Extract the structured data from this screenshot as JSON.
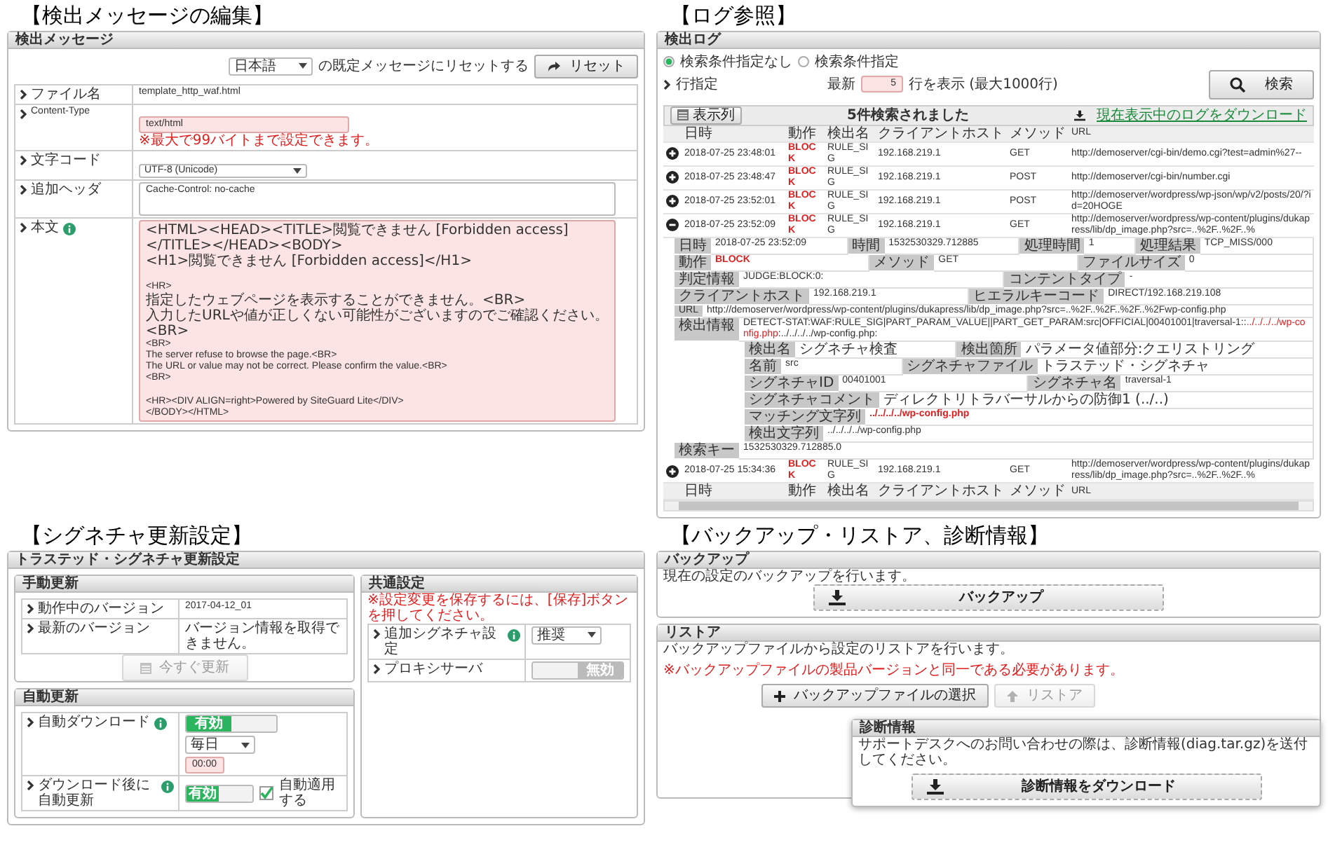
{
  "message_edit": {
    "caption": "【検出メッセージの編集】",
    "header": "検出メッセージ",
    "language": "日本語",
    "reset_text": "の既定メッセージにリセットする",
    "reset_button": "リセット",
    "rows": [
      {
        "kind": "text",
        "label": "ファイル名",
        "value": "template_http_waf.html"
      },
      {
        "kind": "input",
        "label": "Content-Type",
        "value": "text/html",
        "invalid": true,
        "note": "※最大で99バイトまで設定できます。"
      },
      {
        "kind": "select",
        "label": "文字コード",
        "value": "UTF-8 (Unicode)"
      },
      {
        "kind": "textarea",
        "label": "追加ヘッダ",
        "invalid": false,
        "blocks": [
          [
            "Cache-Control: no-cache"
          ]
        ]
      },
      {
        "kind": "textarea",
        "label": "本文",
        "info": true,
        "invalid": true,
        "blocks": [
          [
            "<HTML><HEAD><TITLE>閲覧できません [Forbidden access]</TITLE></HEAD><BODY>",
            "<H1>閲覧できません [Forbidden access]</H1>"
          ],
          [
            "<HR>",
            "指定したウェブページを表示することができません。<BR>",
            "入力したURLや値が正しくない可能性がございますのでご確認ください。<BR>",
            "<BR>",
            "The server refuse to browse the page.<BR>",
            "The URL or value may not be correct. Please confirm the value.<BR>",
            "<BR>"
          ],
          [
            "<HR><DIV ALIGN=right>Powered by SiteGuard Lite</DIV>",
            "</BODY></HTML>"
          ]
        ]
      }
    ]
  },
  "log_view": {
    "caption": "【ログ参照】",
    "header": "検出ログ",
    "radios": [
      {
        "label": "検索条件指定なし",
        "selected": true
      },
      {
        "label": "検索条件指定",
        "selected": false
      }
    ],
    "row_setting": {
      "label": "行指定",
      "prefix": "最新",
      "count": "5",
      "count_invalid": true,
      "suffix": "行を表示 (最大1000行)"
    },
    "search_button": "検索",
    "columns_button": "表示列",
    "result": "5件検索されました",
    "download_link": "現在表示中のログをダウンロード",
    "columns": [
      "日時",
      "動作",
      "検出名",
      "クライアントホスト",
      "メソッド",
      "URL"
    ],
    "rows": [
      {
        "expanded": false,
        "cells": [
          "2018-07-25 23:48:01",
          "BLOCK",
          "RULE_SIG",
          "192.168.219.1",
          "GET",
          "http://demoserver/cgi-bin/demo.cgi?test=admin%27--"
        ]
      },
      {
        "expanded": false,
        "cells": [
          "2018-07-25 23:48:47",
          "BLOCK",
          "RULE_SIG",
          "192.168.219.1",
          "POST",
          "http://demoserver/cgi-bin/number.cgi"
        ]
      },
      {
        "expanded": false,
        "cells": [
          "2018-07-25 23:52:01",
          "BLOCK",
          "RULE_SIG",
          "192.168.219.1",
          "POST",
          "http://demoserver/wordpress/wp-json/wp/v2/posts/20/?id=20HOGE"
        ]
      },
      {
        "expanded": true,
        "cells": [
          "2018-07-25 23:52:09",
          "BLOCK",
          "RULE_SIG",
          "192.168.219.1",
          "GET",
          "http://demoserver/wordpress/wp-content/plugins/dukapress/lib/dp_image.php?src=..%2F..%2F..%"
        ],
        "detail": {
          "rows": [
            [
              {
                "label": "日時",
                "value": "2018-07-25 23:52:09"
              },
              {
                "label": "時間",
                "value": "1532530329.712885"
              },
              {
                "label": "処理時間",
                "value": "1"
              },
              {
                "label": "処理結果",
                "value": "TCP_MISS/000"
              }
            ],
            [
              {
                "label": "動作",
                "value": "BLOCK",
                "alert": true
              },
              {
                "label": "メソッド",
                "value": "GET"
              },
              {
                "label": "ファイルサイズ",
                "value": "0"
              }
            ],
            [
              {
                "label": "判定情報",
                "value": "JUDGE:BLOCK:0:"
              },
              {
                "label": "コンテントタイプ",
                "value": "-"
              }
            ],
            [
              {
                "label": "クライアントホスト",
                "value": "192.168.219.1"
              },
              {
                "label": "ヒエラルキーコード",
                "value": "DIRECT/192.168.219.108"
              }
            ],
            [
              {
                "label": "URL",
                "value": "http://demoserver/wordpress/wp-content/plugins/dukapress/lib/dp_image.php?src=..%2F..%2F..%2F..%2Fwp-config.php"
              }
            ],
            [
              {
                "label": "検出情報",
                "parts": [
                  {
                    "text": "DETECT-STAT:WAF:RULE_SIG|PART_PARAM_VALUE||PART_GET_PARAM:src|OFFICIAL|00401001|traversal-1::",
                    "alert": false
                  },
                  {
                    "text": "../../../../wp-config.php",
                    "alert": true
                  },
                  {
                    "text": ":../../../../wp-config.php:",
                    "alert": false
                  }
                ]
              }
            ]
          ],
          "sub": [
            [
              {
                "label": "検出名",
                "value": "シグネチャ検査"
              },
              {
                "label": "検出箇所",
                "value": "パラメータ値部分:クエリストリング"
              }
            ],
            [
              {
                "label": "名前",
                "value": "src"
              },
              {
                "label": "シグネチャファイル",
                "value": "トラステッド・シグネチャ"
              }
            ],
            [
              {
                "label": "シグネチャID",
                "value": "00401001"
              },
              {
                "label": "シグネチャ名",
                "value": "traversal-1"
              }
            ],
            [
              {
                "label": "シグネチャコメント",
                "value": "ディレクトリトラバーサルからの防御1 (../..)"
              }
            ],
            [
              {
                "label": "マッチング文字列",
                "value": "../../../../wp-config.php",
                "alert": true
              }
            ],
            [
              {
                "label": "検出文字列",
                "value": "../../../../wp-config.php"
              }
            ]
          ],
          "key": {
            "label": "検索キー",
            "value": "1532530329.712885.0"
          }
        }
      },
      {
        "expanded": false,
        "cells": [
          "2018-07-25 15:34:36",
          "BLOCK",
          "RULE_SIG",
          "192.168.219.1",
          "GET",
          "http://demoserver/wordpress/wp-content/plugins/dukapress/lib/dp_image.php?src=..%2F..%2F..%"
        ]
      }
    ],
    "footer_columns": [
      "日時",
      "動作",
      "検出名",
      "クライアントホスト",
      "メソッド",
      "URL"
    ]
  },
  "signature_update": {
    "caption": "【シグネチャ更新設定】",
    "header": "トラステッド・シグネチャ更新設定",
    "manual": {
      "header": "手動更新",
      "rows": [
        {
          "label": "動作中のバージョン",
          "value": "2017-04-12_01"
        },
        {
          "label": "最新のバージョン",
          "value": "バージョン情報を取得できません。"
        }
      ],
      "button": {
        "label": "今すぐ更新",
        "disabled": true
      }
    },
    "auto": {
      "header": "自動更新",
      "rows": [
        {
          "label": "自動ダウンロード",
          "info": true,
          "toggle": {
            "label": "有効",
            "on": true
          },
          "select": "毎日",
          "time": {
            "value": "00:00",
            "invalid": true
          }
        },
        {
          "label": "ダウンロード後に自動更新",
          "info": true,
          "toggle": {
            "label": "有効",
            "on": true
          },
          "checkbox": {
            "label": "自動適用する",
            "checked": true
          }
        }
      ]
    },
    "common": {
      "header": "共通設定",
      "note": "※設定変更を保存するには、[保存]ボタンを押してください。",
      "rows": [
        {
          "label": "追加シグネチャ設定",
          "info": true,
          "select": "推奨"
        },
        {
          "label": "プロキシサーバ",
          "toggle": {
            "label": "無効",
            "on": false
          }
        }
      ]
    }
  },
  "backup_restore": {
    "caption": "【バックアップ・リストア、診断情報】",
    "backup": {
      "header": "バックアップ",
      "text": "現在の設定のバックアップを行います。",
      "button": "バックアップ"
    },
    "restore": {
      "header": "リストア",
      "text": "バックアップファイルから設定のリストアを行います。",
      "warning": "※バックアップファイルの製品バージョンと同一である必要があります。",
      "file_button": "バックアップファイルの選択",
      "restore_button": {
        "label": "リストア",
        "disabled": true
      }
    },
    "diagnostics": {
      "header": "診断情報",
      "text": "サポートデスクへのお問い合わせの際は、診断情報(diag.tar.gz)を送付してください。",
      "button": "診断情報をダウンロード"
    }
  }
}
